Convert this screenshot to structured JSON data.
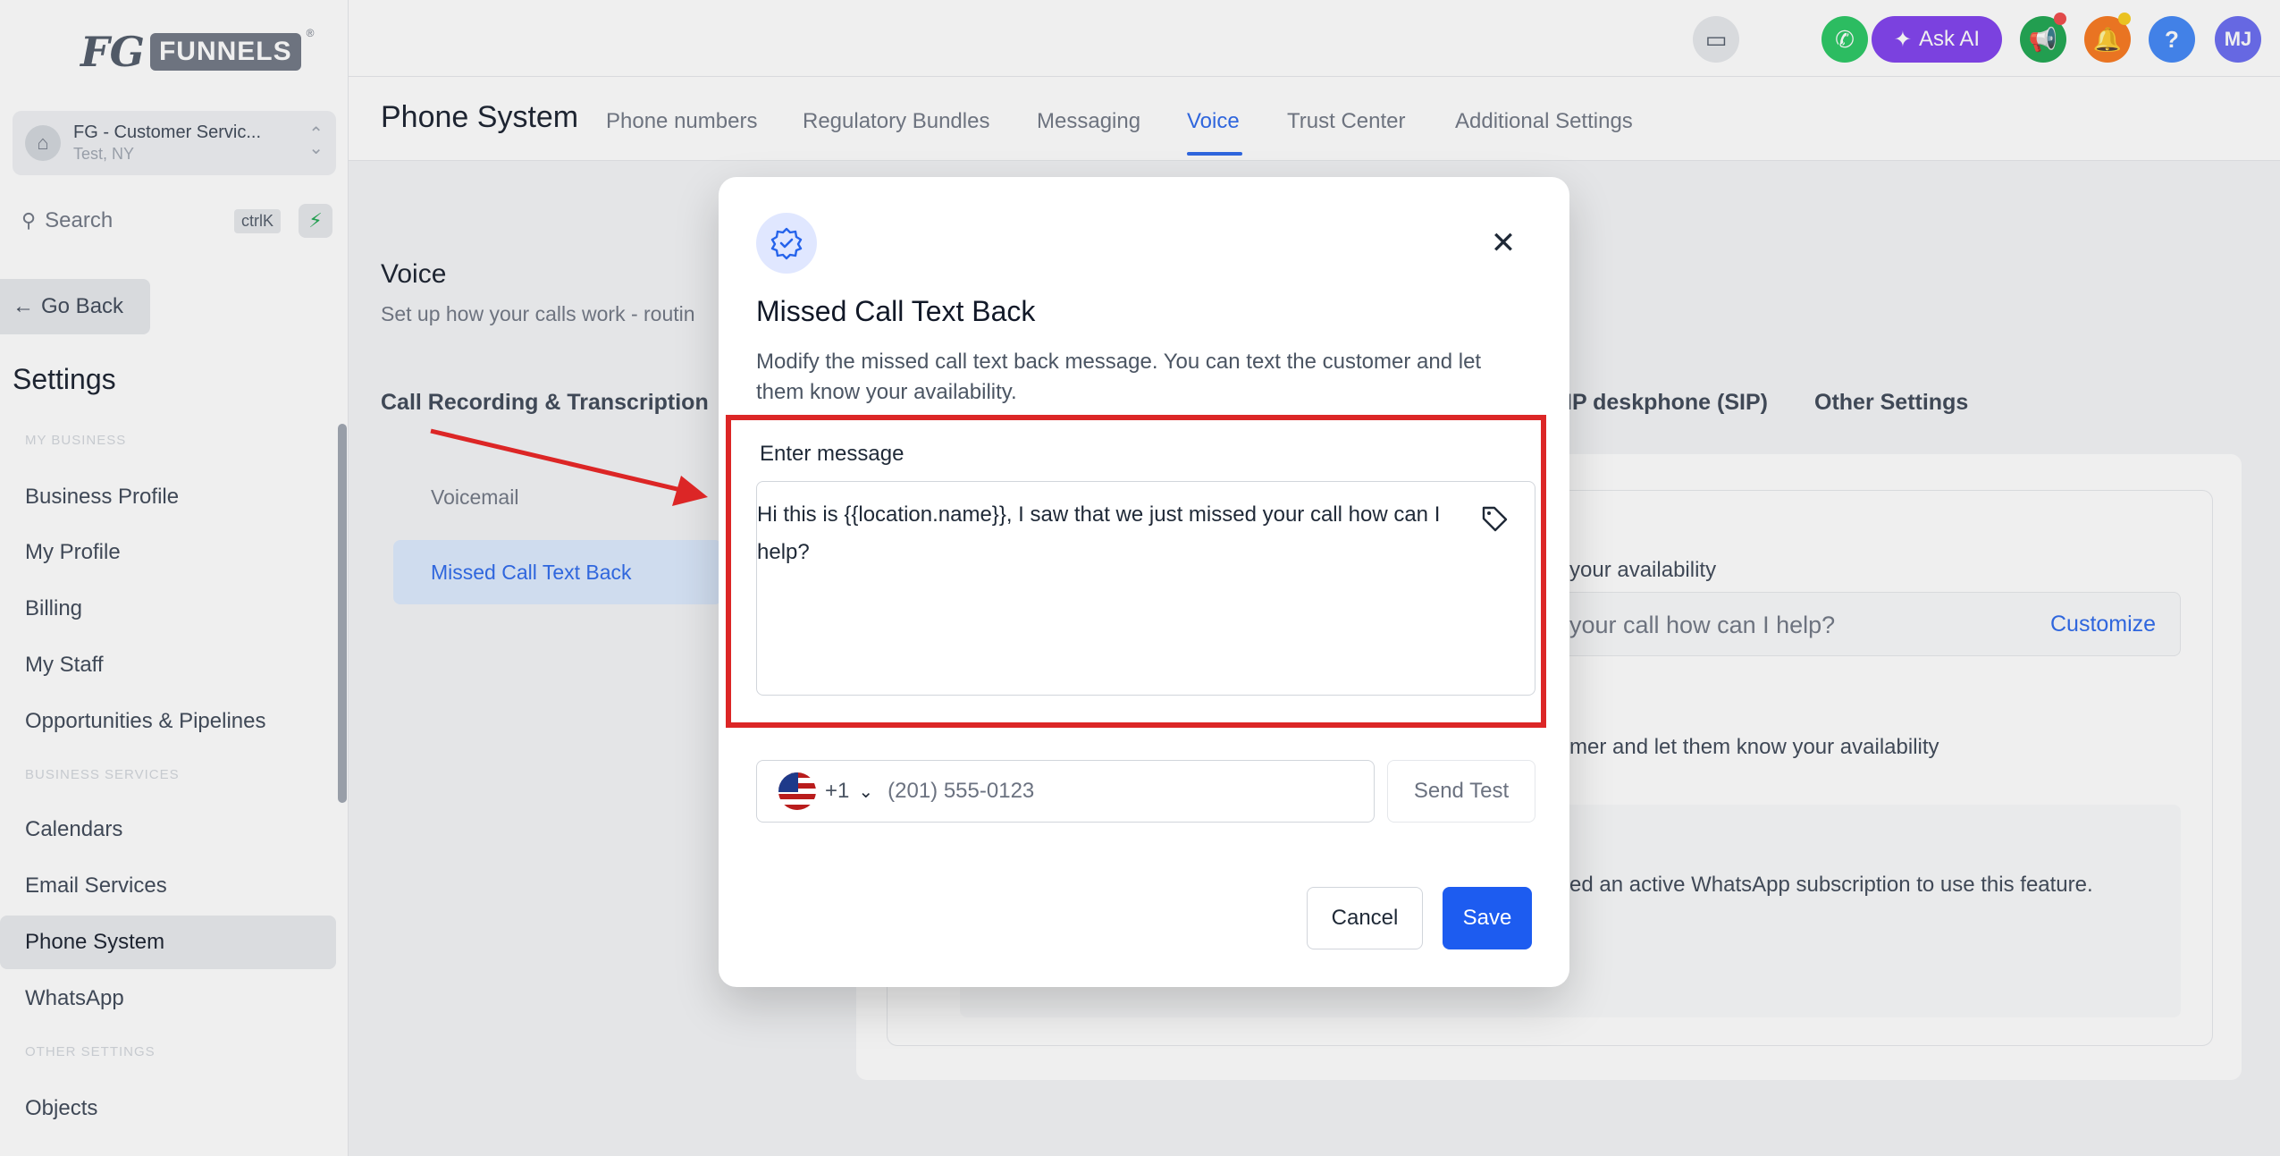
{
  "brand": {
    "logo_fg": "FG",
    "logo_funnels": "FUNNELS",
    "logo_reg": "®"
  },
  "account": {
    "name": "FG - Customer Servic...",
    "location": "Test, NY"
  },
  "search": {
    "label": "Search",
    "shortcut": "ctrlK"
  },
  "sidebar": {
    "go_back": "Go Back",
    "title": "Settings",
    "sections": [
      "MY BUSINESS",
      "BUSINESS SERVICES",
      "OTHER SETTINGS"
    ],
    "items": [
      {
        "label": "Business Profile"
      },
      {
        "label": "My Profile"
      },
      {
        "label": "Billing"
      },
      {
        "label": "My Staff"
      },
      {
        "label": "Opportunities & Pipelines"
      },
      {
        "label": "Calendars"
      },
      {
        "label": "Email Services"
      },
      {
        "label": "Phone System",
        "active": true
      },
      {
        "label": "WhatsApp"
      },
      {
        "label": "Objects"
      }
    ]
  },
  "topbar": {
    "ask_ai": "Ask AI",
    "help": "?",
    "avatar_initials": "MJ",
    "colors": {
      "phone": "#22c55e",
      "ask_ai": "#7c3aed",
      "announce": "#16a34a",
      "bell": "#f97316",
      "help": "#3b82f6",
      "avatar": "#6366f1"
    }
  },
  "page": {
    "title": "Phone System",
    "tabs": [
      {
        "label": "Phone numbers"
      },
      {
        "label": "Regulatory Bundles"
      },
      {
        "label": "Messaging"
      },
      {
        "label": "Voice",
        "active": true
      },
      {
        "label": "Trust Center"
      },
      {
        "label": "Additional Settings"
      }
    ]
  },
  "voice": {
    "title": "Voice",
    "subtitle": "Set up how your calls work - routin",
    "subtabs": [
      "Call Recording & Transcription",
      "IP deskphone (SIP)",
      "Other Settings"
    ],
    "menu": [
      {
        "label": "Voicemail"
      },
      {
        "label": "Missed Call Text Back",
        "active": true
      }
    ],
    "bg_text_1": "your availability",
    "bg_message": "your call how can I help?",
    "customize": "Customize",
    "bg_text_2": "mer and let them know your availability",
    "bg_text_3": "ed an active WhatsApp subscription to use this feature."
  },
  "modal": {
    "title": "Missed Call Text Back",
    "description": "Modify the missed call text back message. You can text the customer and let them know your availability.",
    "message_label": "Enter message",
    "message_value": "Hi this is {{location.name}}, I saw that we just missed your call how can I help?",
    "country_code": "+1",
    "phone_placeholder": "(201) 555-0123",
    "send_test": "Send Test",
    "cancel": "Cancel",
    "save": "Save",
    "close_symbol": "✕"
  },
  "colors": {
    "primary": "#1d5cf0",
    "highlight": "#dc2626",
    "annotation_arrow": "#dc2626"
  }
}
